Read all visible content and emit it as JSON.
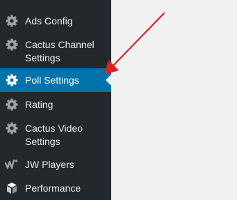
{
  "sidebar": {
    "items": [
      {
        "label": "Ads Config",
        "icon": "gear-icon"
      },
      {
        "label": "Cactus Channel\nSettings",
        "icon": "gear-icon"
      },
      {
        "label": "Poll Settings",
        "icon": "gear-icon",
        "active": true
      },
      {
        "label": "Rating",
        "icon": "gear-icon"
      },
      {
        "label": "Cactus Video\nSettings",
        "icon": "gear-icon"
      },
      {
        "label": "JW Players",
        "icon": "jw-player-icon"
      },
      {
        "label": "Performance",
        "icon": "cube-icon"
      }
    ]
  },
  "colors": {
    "sidebar_bg": "#23282d",
    "active_bg": "#0073aa",
    "content_bg": "#f1f1f1",
    "annotation_arrow": "#e02020"
  }
}
